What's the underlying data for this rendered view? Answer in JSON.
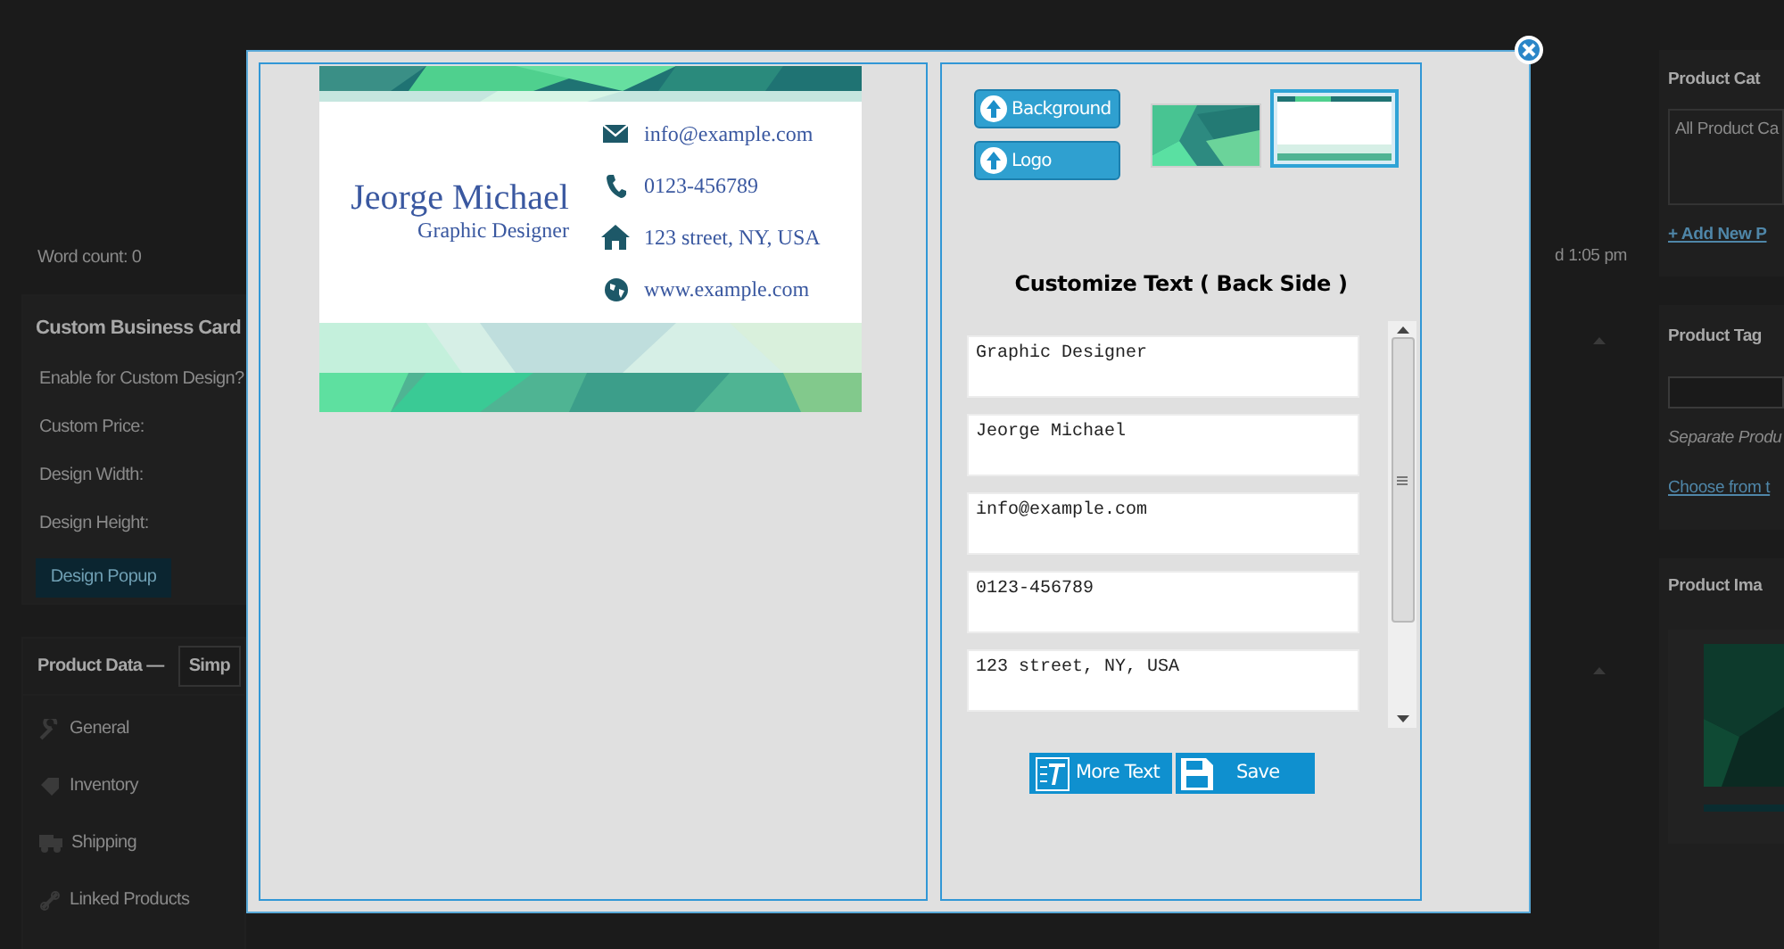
{
  "background_page": {
    "word_count": "Word count: 0",
    "last_edited": "d 1:05 pm",
    "custom_card_box": {
      "title": "Custom Business Card",
      "fields": [
        "Enable for Custom Design?",
        "Custom Price:",
        "Design Width:",
        "Design Height:"
      ],
      "button": "Design Popup"
    },
    "product_data": {
      "title": "Product Data —",
      "type_select": "Simp",
      "tabs": [
        {
          "kind": "general",
          "label": "General"
        },
        {
          "kind": "inventory",
          "label": "Inventory"
        },
        {
          "kind": "shipping",
          "label": "Shipping"
        },
        {
          "kind": "linked",
          "label": "Linked Products"
        }
      ]
    },
    "sidebar": {
      "categories": {
        "title": "Product Cat",
        "item": "All Product Ca",
        "link": "+ Add New P"
      },
      "tags": {
        "title": "Product Tag",
        "hint": "Separate Produ",
        "link": "Choose from t"
      },
      "image": {
        "title": "Product Ima"
      }
    }
  },
  "modal": {
    "card": {
      "name": "Jeorge Michael",
      "job_title": "Graphic Designer",
      "contacts": [
        {
          "kind": "email",
          "text": "info@example.com"
        },
        {
          "kind": "phone",
          "text": "0123-456789"
        },
        {
          "kind": "address",
          "text": "123 street, NY, USA"
        },
        {
          "kind": "web",
          "text": "www.example.com"
        }
      ]
    },
    "upload_buttons": [
      "Background",
      "Logo"
    ],
    "thumbnails": [
      {
        "kind": "front",
        "selected": false
      },
      {
        "kind": "back",
        "selected": true
      }
    ],
    "heading": "Customize Text ( Back Side )",
    "text_fields": [
      "Graphic Designer",
      "Jeorge Michael",
      "info@example.com",
      "0123-456789",
      "123 street, NY, USA"
    ],
    "buttons": [
      {
        "kind": "more_text",
        "label": "More Text"
      },
      {
        "kind": "save",
        "label": "Save"
      }
    ]
  }
}
